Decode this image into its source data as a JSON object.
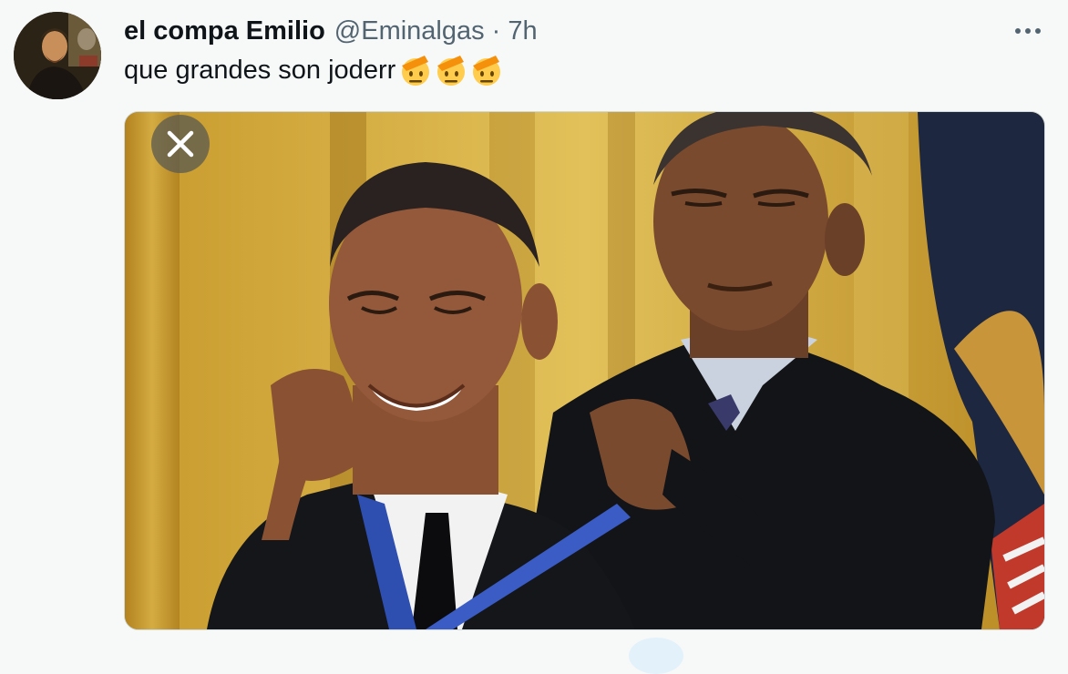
{
  "tweet": {
    "display_name": "el compa Emilio",
    "handle": "@Eminalgas",
    "separator": "·",
    "time": "7h",
    "more_label": "•••",
    "text": "que grandes son joderr",
    "emojis": [
      "saluting-face-emoji",
      "saluting-face-emoji",
      "saluting-face-emoji"
    ]
  },
  "media": {
    "kind": "photo",
    "close_icon": "close-icon"
  },
  "colors": {
    "text_primary": "#0f1419",
    "text_secondary": "#536471",
    "background": "#f7f9f9",
    "border": "#cfd9de"
  }
}
